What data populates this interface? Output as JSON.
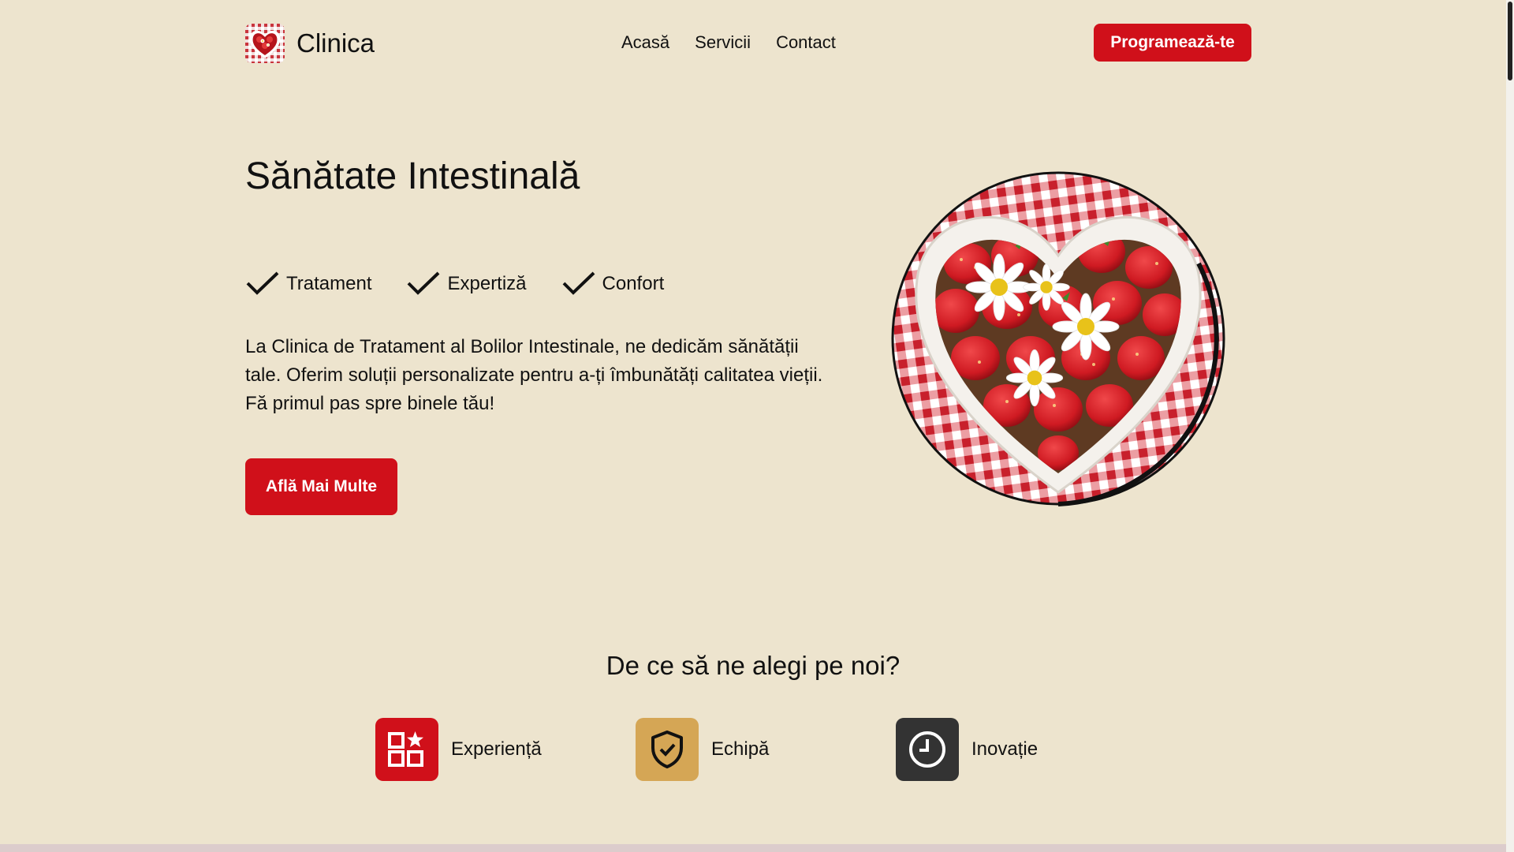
{
  "header": {
    "brand": "Clinica",
    "nav": [
      "Acasă",
      "Servicii",
      "Contact"
    ],
    "cta_label": "Programează-te"
  },
  "hero": {
    "title": "Sănătate Intestinală",
    "features": [
      "Tratament",
      "Expertiză",
      "Confort"
    ],
    "description": "La Clinica de Tratament al Bolilor Intestinale, ne dedicăm sănătății tale. Oferim soluții personalizate pentru a-ți îmbunătăți calitatea vieții. Fă primul pas spre binele tău!",
    "cta_label": "Află Mai Multe"
  },
  "why": {
    "title": "De ce să ne alegi pe noi?",
    "items": [
      {
        "label": "Experiență",
        "icon": "apps-star-icon",
        "color": "#d0101a"
      },
      {
        "label": "Echipă",
        "icon": "shield-check-icon",
        "color": "#d5a655"
      },
      {
        "label": "Inovație",
        "icon": "clock-icon",
        "color": "#333333"
      }
    ]
  },
  "colors": {
    "background": "#ede4ce",
    "accent": "#d0101a",
    "gold": "#d5a655",
    "dark": "#333333"
  }
}
